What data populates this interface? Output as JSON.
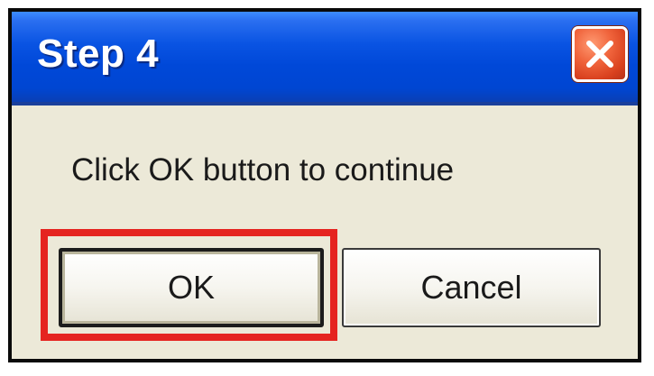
{
  "dialog": {
    "title": "Step 4",
    "message": "Click OK button to continue",
    "close_icon": "close-x-icon",
    "buttons": {
      "ok_label": "OK",
      "cancel_label": "Cancel"
    },
    "highlight_color": "#e52420",
    "titlebar_color": "#0a54e3"
  }
}
